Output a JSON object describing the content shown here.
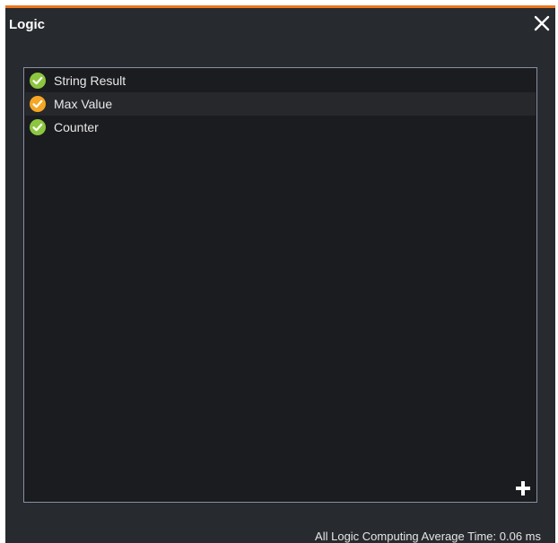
{
  "window": {
    "title": "Logic",
    "accent_color": "#e8771f",
    "background_color": "#272a2e"
  },
  "header": {
    "close_icon": "close-icon"
  },
  "list": {
    "items": [
      {
        "label": "String Result",
        "status": "ok",
        "status_color": "#8cc63f",
        "icon": "check-circle-icon"
      },
      {
        "label": "Max Value",
        "status": "warning",
        "status_color": "#f5a623",
        "icon": "check-circle-icon"
      },
      {
        "label": "Counter",
        "status": "ok",
        "status_color": "#8cc63f",
        "icon": "check-circle-icon"
      }
    ],
    "add_icon": "plus-icon"
  },
  "footer": {
    "status_text": "All Logic Computing Average Time: 0.06 ms"
  }
}
